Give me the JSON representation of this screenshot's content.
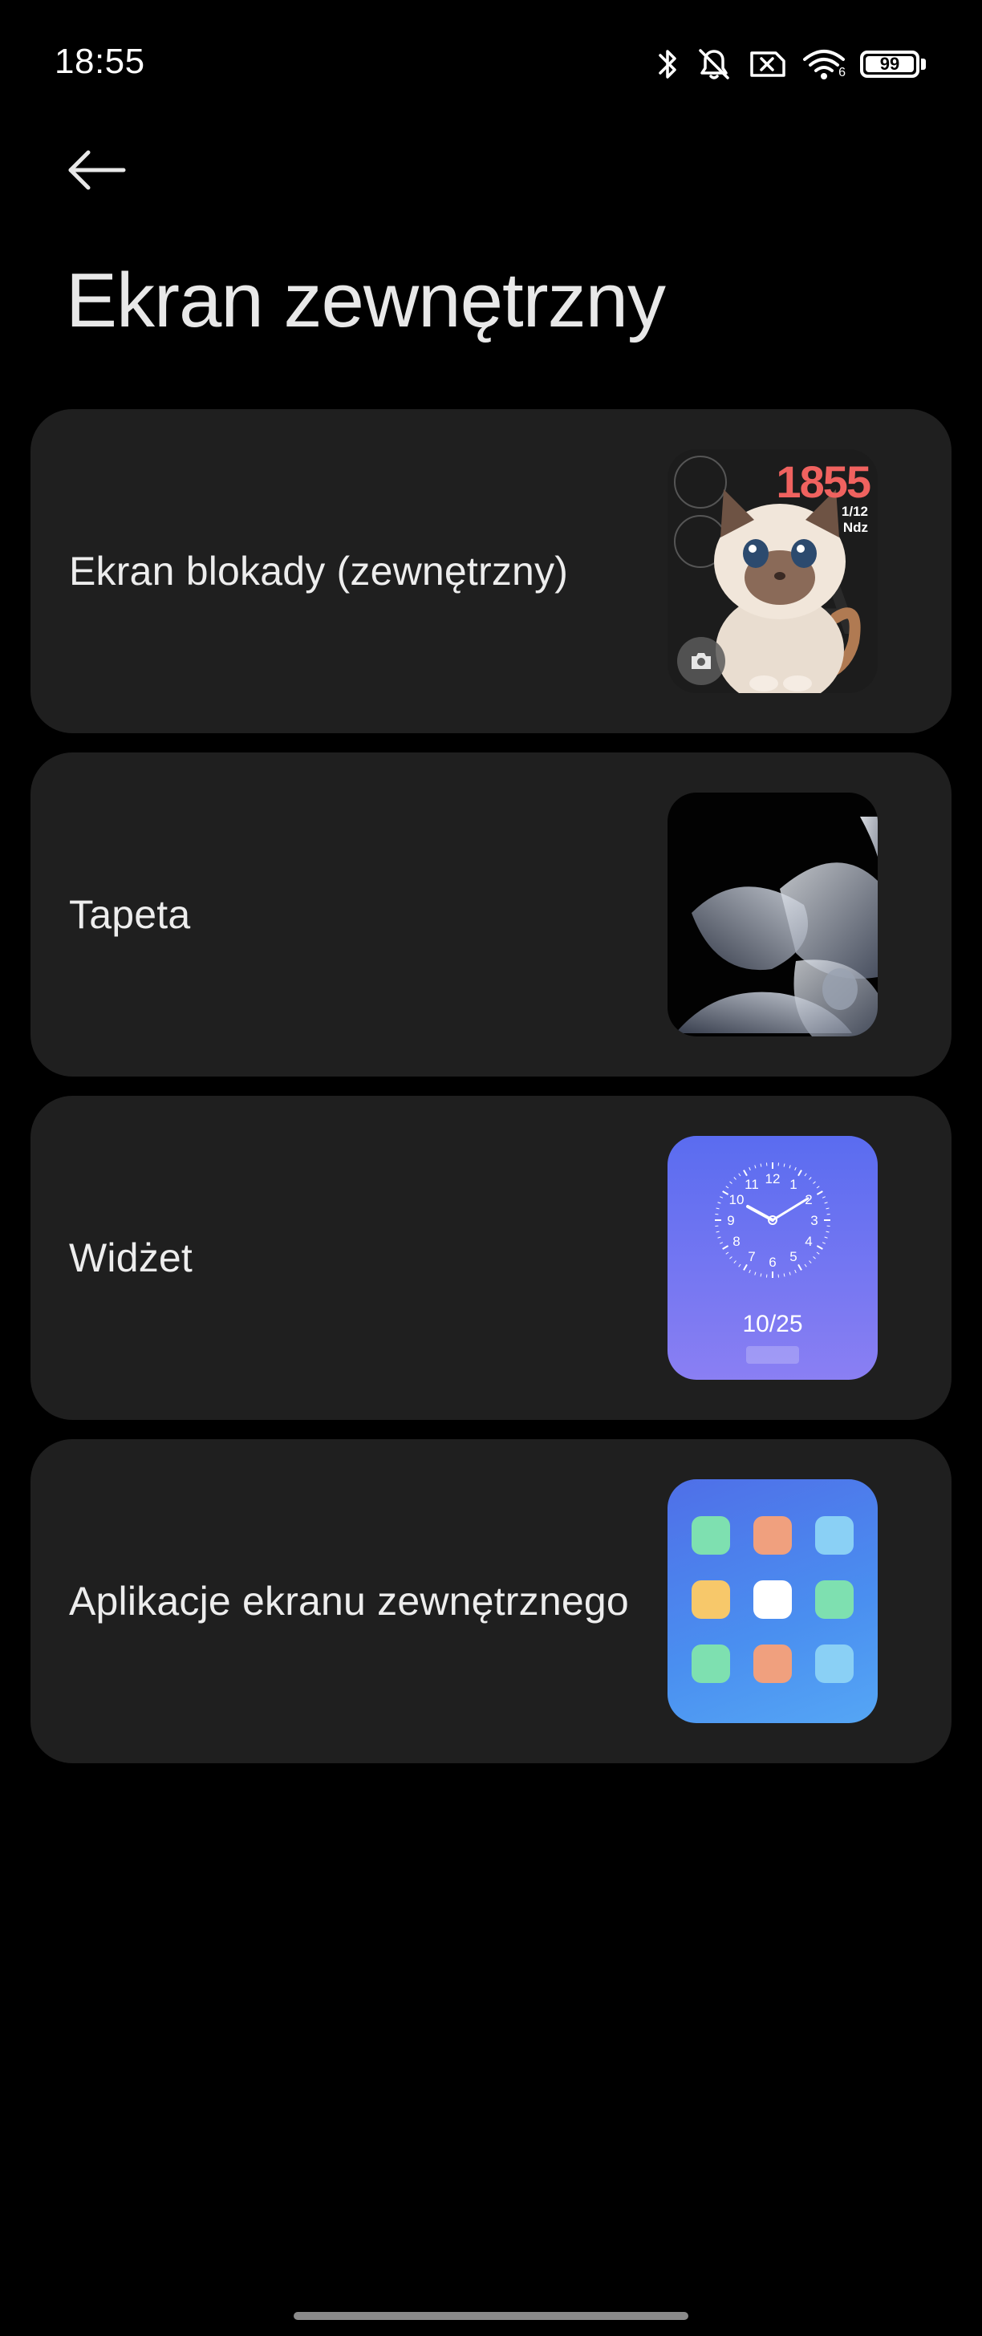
{
  "status_bar": {
    "time": "18:55",
    "battery_level": "99",
    "wifi_label": "6",
    "icons": [
      "bluetooth-icon",
      "mute-icon",
      "no-sim-icon",
      "wifi-icon",
      "battery-icon"
    ]
  },
  "header": {
    "back_icon": "arrow-left-icon",
    "title": "Ekran zewnętrzny"
  },
  "items": [
    {
      "label": "Ekran blokady (zewnętrzny)",
      "preview": {
        "time": "1855",
        "date": "1/12",
        "day": "Ndz",
        "time_color": "#f0625f"
      }
    },
    {
      "label": "Tapeta"
    },
    {
      "label": "Widżet",
      "preview": {
        "date": "10/25",
        "clock_numbers": [
          "12",
          "1",
          "2",
          "3",
          "4",
          "5",
          "6",
          "7",
          "8",
          "9",
          "10",
          "11"
        ]
      }
    },
    {
      "label": "Aplikacje ekranu zewnętrznego",
      "preview": {
        "tile_colors": [
          "#7ee0b0",
          "#f0a07e",
          "#8ad0f5",
          "#f7c86a",
          "#ffffff",
          "#7ee0b0",
          "#7ee0b0",
          "#f0a07e",
          "#8ad0f5"
        ]
      }
    }
  ],
  "colors": {
    "background": "#000000",
    "card": "#1f1f1f",
    "widget_gradient_top": "#5a6cf0",
    "widget_gradient_bottom": "#8a7ff3"
  }
}
